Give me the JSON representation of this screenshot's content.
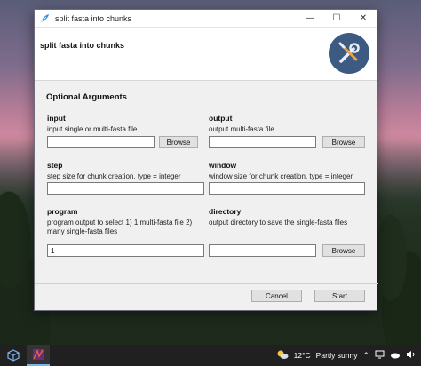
{
  "window": {
    "title": "split fasta into chunks",
    "header_title": "split fasta into chunks",
    "minimize_glyph": "—",
    "maximize_glyph": "☐",
    "close_glyph": "✕"
  },
  "section": {
    "title": "Optional Arguments"
  },
  "fields": {
    "input": {
      "label": "input",
      "help": "input single or multi-fasta file",
      "value": "",
      "button": "Browse"
    },
    "output": {
      "label": "output",
      "help": "output multi-fasta file",
      "value": "",
      "button": "Browse"
    },
    "step": {
      "label": "step",
      "help": "step size for chunk creation, type = integer",
      "value": ""
    },
    "window": {
      "label": "window",
      "help": "window size for chunk creation, type = integer",
      "value": ""
    },
    "program": {
      "label": "program",
      "help": "program output to select 1) 1 multi-fasta file 2) many single-fasta files",
      "value": "1"
    },
    "directory": {
      "label": "directory",
      "help": "output directory to save the single-fasta files",
      "value": "",
      "button": "Browse"
    }
  },
  "footer": {
    "cancel": "Cancel",
    "start": "Start"
  },
  "taskbar": {
    "weather_temp": "12°C",
    "weather_text": "Partly sunny",
    "colors": {
      "bar": "#202020",
      "accent": "#3c5a82"
    }
  },
  "icons": {
    "app": "feather-icon",
    "header": "wrench-screwdriver-icon",
    "taskbar_left": "cube-icon",
    "weather": "sun-cloud-icon"
  }
}
